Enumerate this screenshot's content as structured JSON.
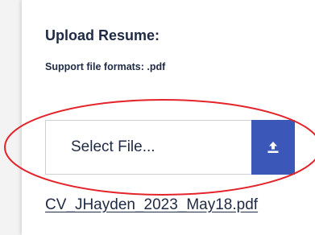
{
  "upload": {
    "title": "Upload Resume:",
    "formats": "Support file formats: .pdf",
    "select_label": "Select File...",
    "upload_icon": "upload-icon",
    "file_name": "CV_JHayden_2023_May18.pdf"
  },
  "colors": {
    "button_bg": "#3b57b8",
    "text": "#1f2a44",
    "annotation": "#e3242b"
  }
}
